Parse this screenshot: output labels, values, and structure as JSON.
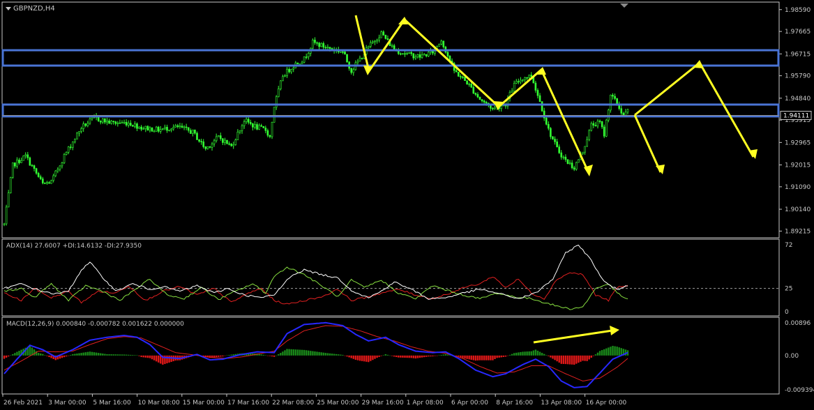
{
  "colors": {
    "background": "#000000",
    "frame": "#c8c8c8",
    "candle": "#33ff33",
    "zone": "#4a74d4",
    "arrow": "#ffff22",
    "adx": "#ffffff",
    "plus_di": "#88e040",
    "minus_di": "#e02020",
    "macd_line": "#2828ff",
    "signal_line": "#e02020",
    "hist_up": "#1a8a1a",
    "hist_down": "#e01818",
    "level_line": "#a0a0a0",
    "text": "#c8c8c8"
  },
  "main": {
    "symbol_label": "GBPNZD,H4",
    "price_ticks": [
      "1.98590",
      "1.97665",
      "1.96715",
      "1.95790",
      "1.94840",
      "1.93915",
      "1.92965",
      "1.92015",
      "1.91090",
      "1.90140",
      "1.89215"
    ],
    "current_price": "1.94111"
  },
  "adx_panel": {
    "label": "ADX(14) 27.6007 +DI:14.6132 -DI:27.9350",
    "ticks": [
      "72",
      "25",
      "0"
    ]
  },
  "macd_panel": {
    "label": "MACD(12,26,9) 0.000840 -0.000782 0.001622 0.000000",
    "ticks": [
      "0.00896",
      "0.00",
      "-0.009394"
    ]
  },
  "time_axis": {
    "labels": [
      "26 Feb 2021",
      "3 Mar 00:00",
      "5 Mar 16:00",
      "10 Mar 08:00",
      "15 Mar 00:00",
      "17 Mar 16:00",
      "22 Mar 08:00",
      "25 Mar 00:00",
      "29 Mar 16:00",
      "1 Apr 08:00",
      "6 Apr 00:00",
      "8 Apr 16:00",
      "13 Apr 08:00",
      "16 Apr 00:00"
    ]
  },
  "chart_data": {
    "type": "candlestick",
    "symbol": "GBPNZD",
    "timeframe": "H4",
    "price_range": [
      1.8902,
      1.9876
    ],
    "close_anchors": [
      [
        0,
        1.895
      ],
      [
        4,
        1.92
      ],
      [
        10,
        1.924
      ],
      [
        18,
        1.912
      ],
      [
        22,
        1.913
      ],
      [
        28,
        1.924
      ],
      [
        36,
        1.936
      ],
      [
        42,
        1.94
      ],
      [
        50,
        1.938
      ],
      [
        58,
        1.938
      ],
      [
        64,
        1.936
      ],
      [
        72,
        1.935
      ],
      [
        78,
        1.936
      ],
      [
        82,
        1.936
      ],
      [
        88,
        1.934
      ],
      [
        94,
        1.927
      ],
      [
        100,
        1.932
      ],
      [
        106,
        1.928
      ],
      [
        112,
        1.939
      ],
      [
        118,
        1.936
      ],
      [
        122,
        1.935
      ],
      [
        124,
        1.932
      ],
      [
        126,
        1.945
      ],
      [
        130,
        1.958
      ],
      [
        136,
        1.963
      ],
      [
        140,
        1.965
      ],
      [
        144,
        1.972
      ],
      [
        150,
        1.97
      ],
      [
        154,
        1.969
      ],
      [
        158,
        1.968
      ],
      [
        162,
        1.96
      ],
      [
        166,
        1.965
      ],
      [
        170,
        1.97
      ],
      [
        176,
        1.976
      ],
      [
        182,
        1.969
      ],
      [
        188,
        1.967
      ],
      [
        194,
        1.966
      ],
      [
        200,
        1.968
      ],
      [
        204,
        1.973
      ],
      [
        210,
        1.96
      ],
      [
        216,
        1.955
      ],
      [
        222,
        1.948
      ],
      [
        228,
        1.944
      ],
      [
        234,
        1.946
      ],
      [
        238,
        1.954
      ],
      [
        242,
        1.957
      ],
      [
        246,
        1.958
      ],
      [
        250,
        1.947
      ],
      [
        254,
        1.935
      ],
      [
        258,
        1.927
      ],
      [
        262,
        1.922
      ],
      [
        266,
        1.919
      ],
      [
        270,
        1.926
      ],
      [
        274,
        1.937
      ],
      [
        278,
        1.938
      ],
      [
        280,
        1.933
      ],
      [
        283,
        1.95
      ],
      [
        286,
        1.946
      ],
      [
        289,
        1.941
      ],
      [
        291,
        1.943
      ]
    ],
    "candle_count": 292,
    "resistance_zone_upper": [
      1.9622,
      1.9687
    ],
    "resistance_zone_lower": [
      1.9407,
      1.9457
    ],
    "adx": {
      "range": [
        0,
        72
      ],
      "level": 25,
      "adx_anchors": [
        [
          0,
          25
        ],
        [
          8,
          30
        ],
        [
          16,
          23
        ],
        [
          24,
          19
        ],
        [
          30,
          22
        ],
        [
          36,
          45
        ],
        [
          40,
          53
        ],
        [
          46,
          37
        ],
        [
          52,
          22
        ],
        [
          60,
          30
        ],
        [
          68,
          24
        ],
        [
          74,
          27
        ],
        [
          82,
          22
        ],
        [
          90,
          28
        ],
        [
          98,
          20
        ],
        [
          104,
          25
        ],
        [
          112,
          18
        ],
        [
          120,
          15
        ],
        [
          126,
          18
        ],
        [
          134,
          39
        ],
        [
          140,
          45
        ],
        [
          148,
          40
        ],
        [
          156,
          36
        ],
        [
          162,
          23
        ],
        [
          170,
          15
        ],
        [
          176,
          22
        ],
        [
          182,
          32
        ],
        [
          190,
          24
        ],
        [
          198,
          14
        ],
        [
          206,
          15
        ],
        [
          214,
          20
        ],
        [
          222,
          24
        ],
        [
          230,
          20
        ],
        [
          240,
          14
        ],
        [
          248,
          20
        ],
        [
          256,
          35
        ],
        [
          262,
          63
        ],
        [
          268,
          72
        ],
        [
          274,
          55
        ],
        [
          280,
          32
        ],
        [
          286,
          24
        ],
        [
          291,
          28
        ]
      ],
      "plus_di_anchors": [
        [
          0,
          22
        ],
        [
          8,
          25
        ],
        [
          14,
          15
        ],
        [
          22,
          30
        ],
        [
          30,
          12
        ],
        [
          38,
          28
        ],
        [
          46,
          22
        ],
        [
          54,
          12
        ],
        [
          60,
          22
        ],
        [
          68,
          35
        ],
        [
          76,
          18
        ],
        [
          84,
          14
        ],
        [
          92,
          26
        ],
        [
          100,
          13
        ],
        [
          108,
          22
        ],
        [
          116,
          30
        ],
        [
          122,
          20
        ],
        [
          126,
          38
        ],
        [
          132,
          48
        ],
        [
          140,
          40
        ],
        [
          148,
          28
        ],
        [
          156,
          16
        ],
        [
          162,
          34
        ],
        [
          168,
          26
        ],
        [
          176,
          34
        ],
        [
          184,
          20
        ],
        [
          192,
          14
        ],
        [
          200,
          28
        ],
        [
          208,
          22
        ],
        [
          214,
          18
        ],
        [
          222,
          14
        ],
        [
          230,
          20
        ],
        [
          238,
          16
        ],
        [
          246,
          14
        ],
        [
          252,
          10
        ],
        [
          258,
          6
        ],
        [
          264,
          3
        ],
        [
          270,
          5
        ],
        [
          276,
          25
        ],
        [
          282,
          30
        ],
        [
          286,
          20
        ],
        [
          291,
          13
        ]
      ],
      "minus_di_anchors": [
        [
          0,
          20
        ],
        [
          8,
          12
        ],
        [
          14,
          25
        ],
        [
          22,
          15
        ],
        [
          30,
          22
        ],
        [
          36,
          10
        ],
        [
          44,
          22
        ],
        [
          52,
          20
        ],
        [
          58,
          28
        ],
        [
          66,
          12
        ],
        [
          74,
          22
        ],
        [
          82,
          27
        ],
        [
          90,
          18
        ],
        [
          98,
          25
        ],
        [
          106,
          10
        ],
        [
          114,
          20
        ],
        [
          120,
          25
        ],
        [
          126,
          12
        ],
        [
          132,
          8
        ],
        [
          140,
          12
        ],
        [
          148,
          16
        ],
        [
          156,
          24
        ],
        [
          162,
          12
        ],
        [
          168,
          15
        ],
        [
          176,
          20
        ],
        [
          184,
          24
        ],
        [
          192,
          18
        ],
        [
          200,
          14
        ],
        [
          208,
          20
        ],
        [
          216,
          27
        ],
        [
          222,
          30
        ],
        [
          228,
          38
        ],
        [
          234,
          26
        ],
        [
          240,
          35
        ],
        [
          246,
          20
        ],
        [
          252,
          14
        ],
        [
          258,
          35
        ],
        [
          264,
          42
        ],
        [
          270,
          40
        ],
        [
          276,
          18
        ],
        [
          282,
          12
        ],
        [
          286,
          26
        ],
        [
          291,
          28
        ]
      ]
    },
    "macd": {
      "range": [
        -0.009394,
        0.00896
      ],
      "macd_anchors": [
        [
          0,
          -0.005
        ],
        [
          6,
          -0.001
        ],
        [
          12,
          0.0028
        ],
        [
          18,
          0.0016
        ],
        [
          24,
          -0.0004
        ],
        [
          32,
          0.0016
        ],
        [
          40,
          0.0042
        ],
        [
          48,
          0.005
        ],
        [
          56,
          0.0055
        ],
        [
          62,
          0.005
        ],
        [
          68,
          0.003
        ],
        [
          74,
          -0.0005
        ],
        [
          82,
          -0.0008
        ],
        [
          90,
          0.0003
        ],
        [
          96,
          -0.0012
        ],
        [
          102,
          -0.001
        ],
        [
          110,
          0.0002
        ],
        [
          118,
          0.001
        ],
        [
          126,
          0.0008
        ],
        [
          132,
          0.006
        ],
        [
          140,
          0.0085
        ],
        [
          150,
          0.009
        ],
        [
          158,
          0.0082
        ],
        [
          164,
          0.0058
        ],
        [
          170,
          0.004
        ],
        [
          178,
          0.005
        ],
        [
          184,
          0.003
        ],
        [
          192,
          0.0012
        ],
        [
          200,
          0.0008
        ],
        [
          206,
          0.001
        ],
        [
          212,
          -0.0008
        ],
        [
          220,
          -0.004
        ],
        [
          228,
          -0.0058
        ],
        [
          234,
          -0.005
        ],
        [
          242,
          -0.0025
        ],
        [
          248,
          -0.001
        ],
        [
          254,
          -0.003
        ],
        [
          260,
          -0.007
        ],
        [
          266,
          -0.0088
        ],
        [
          272,
          -0.0085
        ],
        [
          278,
          -0.0048
        ],
        [
          284,
          -0.001
        ],
        [
          291,
          0.0008
        ]
      ],
      "signal_anchors": [
        [
          0,
          -0.004
        ],
        [
          8,
          -0.0015
        ],
        [
          16,
          0.0012
        ],
        [
          24,
          0.001
        ],
        [
          32,
          0.0012
        ],
        [
          40,
          0.003
        ],
        [
          48,
          0.0046
        ],
        [
          56,
          0.0052
        ],
        [
          64,
          0.0048
        ],
        [
          72,
          0.0028
        ],
        [
          80,
          0.0008
        ],
        [
          88,
          0.0002
        ],
        [
          96,
          -0.0005
        ],
        [
          104,
          -0.0008
        ],
        [
          112,
          -0.0003
        ],
        [
          120,
          0.0006
        ],
        [
          126,
          0.0012
        ],
        [
          132,
          0.004
        ],
        [
          140,
          0.0068
        ],
        [
          150,
          0.0082
        ],
        [
          158,
          0.008
        ],
        [
          166,
          0.0068
        ],
        [
          174,
          0.0052
        ],
        [
          182,
          0.004
        ],
        [
          190,
          0.0024
        ],
        [
          198,
          0.0012
        ],
        [
          206,
          0.0006
        ],
        [
          214,
          -0.0008
        ],
        [
          222,
          -0.003
        ],
        [
          230,
          -0.0048
        ],
        [
          238,
          -0.0045
        ],
        [
          246,
          -0.0028
        ],
        [
          254,
          -0.0028
        ],
        [
          262,
          -0.005
        ],
        [
          270,
          -0.007
        ],
        [
          278,
          -0.0062
        ],
        [
          286,
          -0.0032
        ],
        [
          291,
          -0.0008
        ]
      ]
    }
  }
}
